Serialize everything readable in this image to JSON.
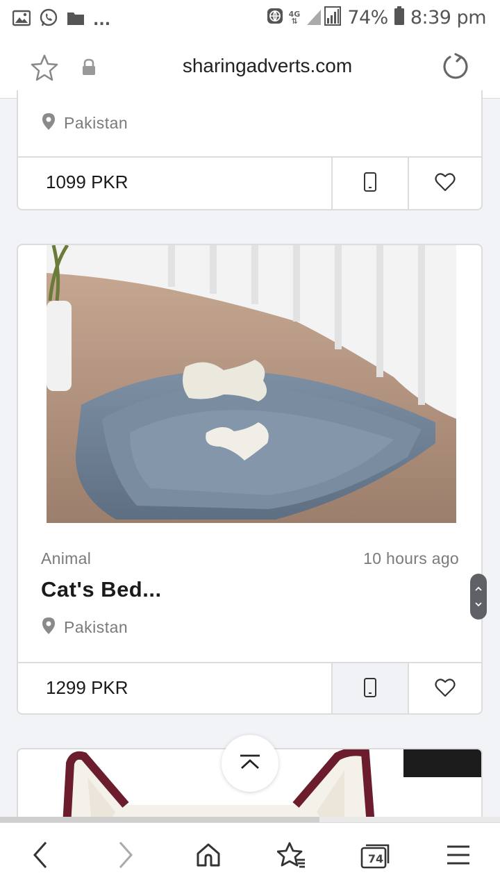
{
  "status_bar": {
    "more_indicator": "...",
    "network": "4G",
    "battery": "74%",
    "time": "8:39 pm"
  },
  "address_bar": {
    "url": "sharingadverts.com"
  },
  "listings": [
    {
      "location": "Pakistan",
      "price": "1099 PKR"
    },
    {
      "category": "Animal",
      "posted": "10 hours ago",
      "title": "Cat's Bed...",
      "location": "Pakistan",
      "price": "1299 PKR"
    }
  ],
  "bottom_nav": {
    "tabs_count": "74"
  },
  "colors": {
    "accent_border": "#dcdcdc",
    "muted_text": "#7a7a7a",
    "background": "#f2f3f7"
  },
  "icons": [
    "image-icon",
    "whatsapp-icon",
    "folder-icon",
    "globe-icon",
    "signal-icon",
    "battery-icon",
    "star-icon",
    "lock-icon",
    "reload-icon",
    "location-pin-icon",
    "phone-icon",
    "heart-icon",
    "back-icon",
    "forward-icon",
    "home-icon",
    "bookmarks-icon",
    "tabs-icon",
    "menu-icon",
    "scroll-to-top-icon"
  ]
}
